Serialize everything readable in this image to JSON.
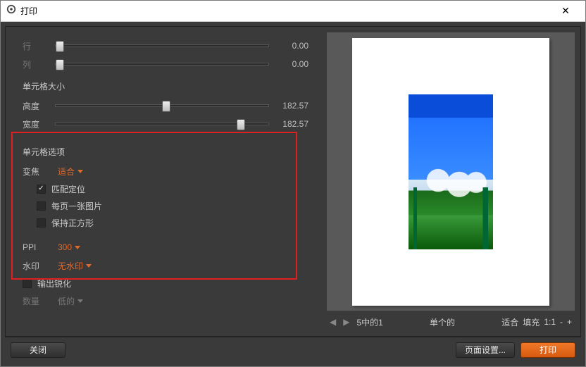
{
  "title": "打印",
  "sliders": {
    "row": {
      "label": "行",
      "value": "0.00",
      "pos": 2
    },
    "col": {
      "label": "列",
      "value": "0.00",
      "pos": 2
    },
    "height": {
      "label": "高度",
      "value": "182.57",
      "pos": 52
    },
    "width": {
      "label": "宽度",
      "value": "182.57",
      "pos": 87
    }
  },
  "cell_size_title": "单元格大小",
  "cell_options": {
    "title": "单元格选项",
    "zoom_label": "变焦",
    "zoom_value": "适合",
    "chk_align": "匹配定位",
    "chk_one_per_page": "每页一张图片",
    "chk_keep_square": "保持正方形",
    "ppi_label": "PPI",
    "ppi_value": "300",
    "watermark_label": "水印",
    "watermark_value": "无水印"
  },
  "output_sharpen": {
    "chk_label": "输出锐化",
    "amount_label": "数量",
    "amount_value": "低的"
  },
  "preview_bar": {
    "page_counter": "5中的1",
    "mode": "单个的",
    "fit": "适合",
    "fill": "填充",
    "zoom": "1:1"
  },
  "footer": {
    "close": "关闭",
    "page_setup": "页面设置...",
    "print": "打印"
  }
}
